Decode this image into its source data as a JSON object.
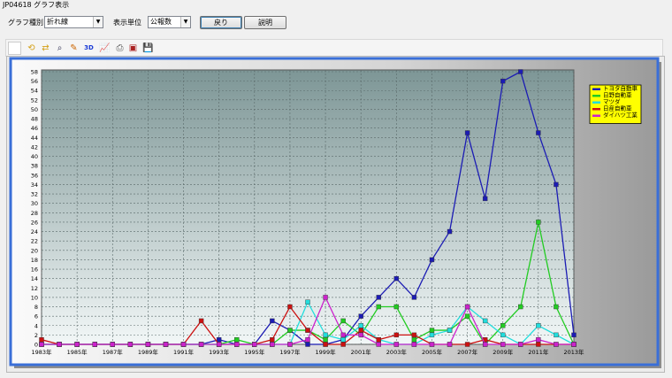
{
  "window": {
    "title": "JP04618 グラフ表示"
  },
  "controls": {
    "chart_type_label": "グラフ種別",
    "chart_type_value": "折れ線",
    "unit_label": "表示単位",
    "unit_value": "公報数",
    "back_button": "戻り",
    "help_button": "説明"
  },
  "toolbar": {
    "items": [
      "blank-icon",
      "rotate-icon",
      "swap-icon",
      "zoom-icon",
      "pencil-icon",
      "3d-icon",
      "chart-edit-icon",
      "print-icon",
      "export-icon",
      "save-icon"
    ],
    "three_d_label": "3D"
  },
  "colors": {
    "plot_bg_top": "#7d9696",
    "plot_bg_bottom": "#f2f7f7",
    "frame_blue": "#3a6fd8"
  },
  "chart_data": {
    "type": "line",
    "x": [
      1983,
      1984,
      1985,
      1986,
      1987,
      1988,
      1989,
      1990,
      1991,
      1992,
      1993,
      1994,
      1995,
      1996,
      1997,
      1998,
      1999,
      2000,
      2001,
      2002,
      2003,
      2004,
      2005,
      2006,
      2007,
      2008,
      2009,
      2010,
      2011,
      2012,
      2013
    ],
    "xticks": [
      "1983年",
      "1985年",
      "1987年",
      "1989年",
      "1991年",
      "1993年",
      "1995年",
      "1997年",
      "1999年",
      "2001年",
      "2003年",
      "2005年",
      "2007年",
      "2009年",
      "2011年",
      "2013年"
    ],
    "ylim": [
      0,
      58
    ],
    "yticks": [
      0,
      2,
      4,
      6,
      8,
      10,
      12,
      14,
      16,
      18,
      20,
      22,
      24,
      26,
      28,
      30,
      32,
      34,
      36,
      38,
      40,
      42,
      44,
      46,
      48,
      50,
      52,
      54,
      56,
      58
    ],
    "grid": true,
    "legend_position": "top-right",
    "series": [
      {
        "name": "トヨタ自動車",
        "color": "#1c1cb4",
        "values": [
          0,
          0,
          0,
          0,
          0,
          0,
          0,
          0,
          0,
          0,
          1,
          0,
          0,
          5,
          3,
          0,
          0,
          1,
          6,
          10,
          14,
          10,
          18,
          24,
          45,
          31,
          56,
          58,
          45,
          34,
          2
        ]
      },
      {
        "name": "日野自動車",
        "color": "#22cc22",
        "values": [
          0,
          0,
          0,
          0,
          0,
          0,
          0,
          0,
          0,
          0,
          0,
          1,
          0,
          0,
          3,
          3,
          1,
          5,
          2,
          8,
          8,
          1,
          3,
          3,
          6,
          0,
          4,
          8,
          26,
          8,
          0
        ]
      },
      {
        "name": "マツダ",
        "color": "#22dddd",
        "values": [
          0,
          0,
          0,
          0,
          0,
          0,
          0,
          0,
          0,
          0,
          0,
          0,
          0,
          0,
          0,
          9,
          2,
          1,
          4,
          1,
          0,
          0,
          2,
          3,
          8,
          5,
          2,
          0,
          4,
          2,
          0
        ]
      },
      {
        "name": "日産自動車",
        "color": "#cc1111",
        "values": [
          1,
          0,
          0,
          0,
          0,
          0,
          0,
          0,
          0,
          5,
          0,
          0,
          0,
          1,
          8,
          3,
          0,
          0,
          3,
          1,
          2,
          2,
          0,
          0,
          0,
          1,
          0,
          0,
          0,
          0,
          0
        ]
      },
      {
        "name": "ダイハツ工業",
        "color": "#cc22cc",
        "values": [
          0,
          0,
          0,
          0,
          0,
          0,
          0,
          0,
          0,
          0,
          0,
          0,
          0,
          0,
          0,
          1,
          10,
          2,
          2,
          0,
          0,
          0,
          0,
          0,
          8,
          0,
          0,
          0,
          1,
          0,
          0
        ]
      }
    ]
  }
}
